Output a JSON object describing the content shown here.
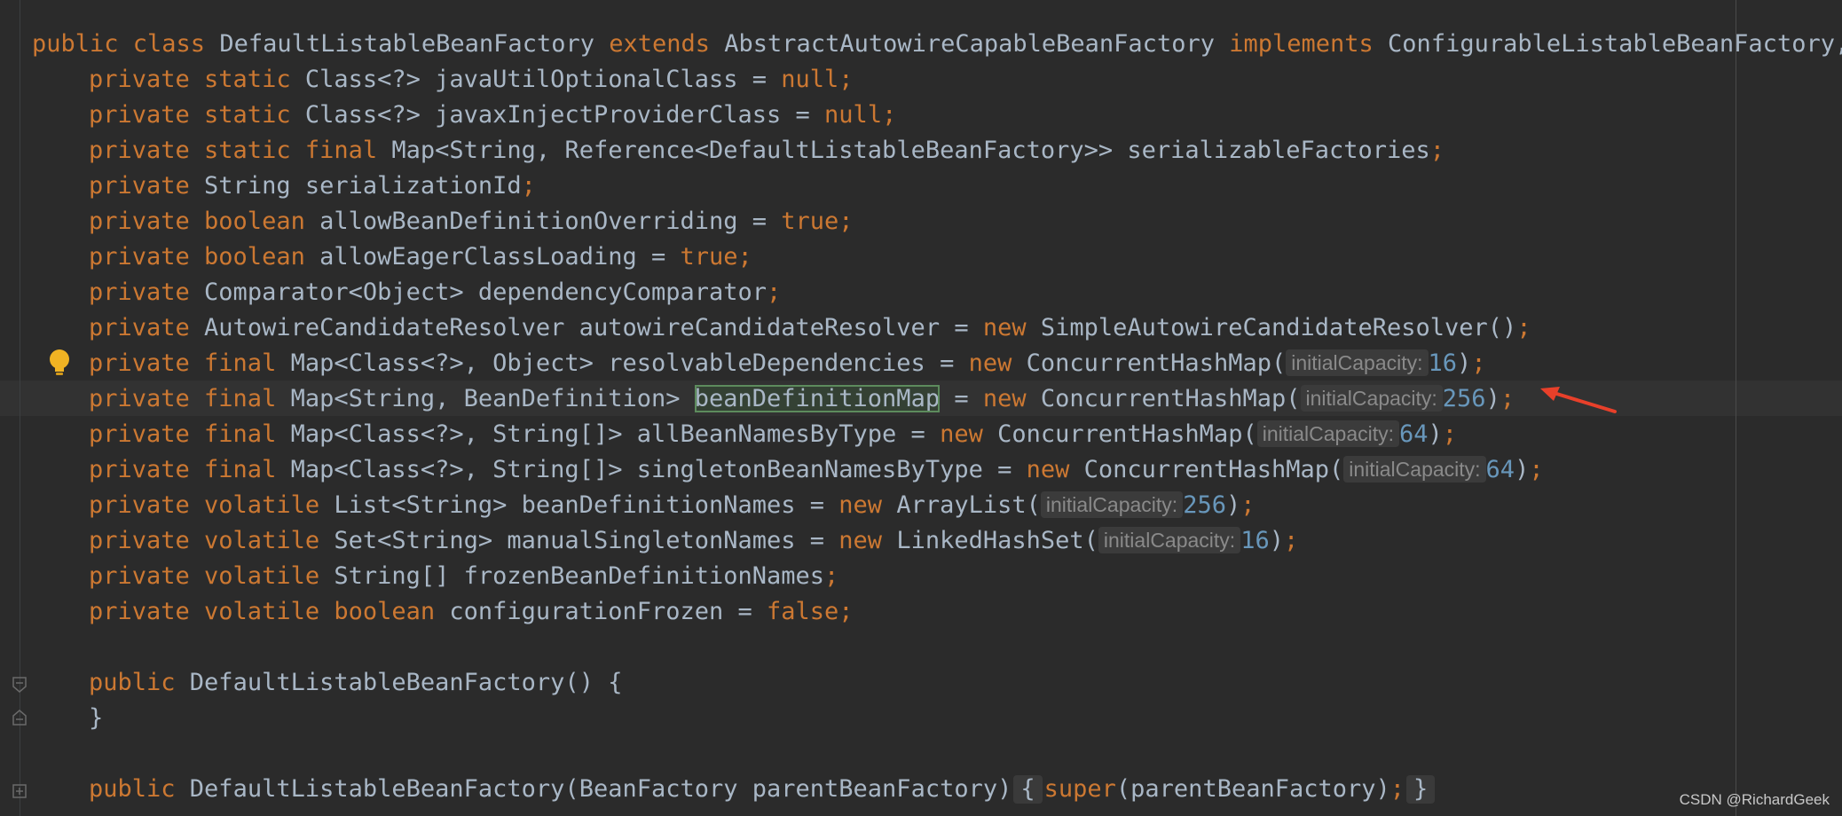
{
  "code": {
    "lines": [
      [
        {
          "t": "public class ",
          "c": "kw"
        },
        {
          "t": "DefaultListableBeanFactory "
        },
        {
          "t": "extends ",
          "c": "kw"
        },
        {
          "t": "AbstractAutowireCapableBeanFactory "
        },
        {
          "t": "implements ",
          "c": "kw"
        },
        {
          "t": "ConfigurableListableBeanFactory, B"
        }
      ],
      [
        {
          "i": 1
        },
        {
          "t": "private static ",
          "c": "kw"
        },
        {
          "t": "Class<?> javaUtilOptionalClass = "
        },
        {
          "t": "null;",
          "c": "kw"
        }
      ],
      [
        {
          "i": 1
        },
        {
          "t": "private static ",
          "c": "kw"
        },
        {
          "t": "Class<?> javaxInjectProviderClass = "
        },
        {
          "t": "null;",
          "c": "kw"
        }
      ],
      [
        {
          "i": 1
        },
        {
          "t": "private static final ",
          "c": "kw"
        },
        {
          "t": "Map<String, Reference<DefaultListableBeanFactory>> serializableFactories"
        },
        {
          "t": ";",
          "c": "kw"
        }
      ],
      [
        {
          "i": 1
        },
        {
          "t": "private ",
          "c": "kw"
        },
        {
          "t": "String serializationId"
        },
        {
          "t": ";",
          "c": "kw"
        }
      ],
      [
        {
          "i": 1
        },
        {
          "t": "private boolean ",
          "c": "kw"
        },
        {
          "t": "allowBeanDefinitionOverriding = "
        },
        {
          "t": "true;",
          "c": "kw"
        }
      ],
      [
        {
          "i": 1
        },
        {
          "t": "private boolean ",
          "c": "kw"
        },
        {
          "t": "allowEagerClassLoading = "
        },
        {
          "t": "true;",
          "c": "kw"
        }
      ],
      [
        {
          "i": 1
        },
        {
          "t": "private ",
          "c": "kw"
        },
        {
          "t": "Comparator<Object> dependencyComparator"
        },
        {
          "t": ";",
          "c": "kw"
        }
      ],
      [
        {
          "i": 1
        },
        {
          "t": "private ",
          "c": "kw"
        },
        {
          "t": "AutowireCandidateResolver autowireCandidateResolver = "
        },
        {
          "t": "new ",
          "c": "kw"
        },
        {
          "t": "SimpleAutowireCandidateResolver()"
        },
        {
          "t": ";",
          "c": "kw"
        }
      ],
      [
        {
          "i": 1
        },
        {
          "t": "private final ",
          "c": "kw"
        },
        {
          "t": "Map<Class<?>, Object> resolvableDependencies = "
        },
        {
          "t": "new ",
          "c": "kw"
        },
        {
          "t": "ConcurrentHashMap("
        },
        {
          "h": "initialCapacity:"
        },
        {
          "t": "16",
          "c": "num"
        },
        {
          "t": ")"
        },
        {
          "t": ";",
          "c": "kw"
        }
      ],
      [
        {
          "i": 1
        },
        {
          "t": "private final ",
          "c": "kw"
        },
        {
          "t": "Map<String, BeanDefinition> "
        },
        {
          "t": "beanDefinitionMap",
          "c": "sel"
        },
        {
          "t": " = "
        },
        {
          "t": "new ",
          "c": "kw"
        },
        {
          "t": "ConcurrentHashMap("
        },
        {
          "h": "initialCapacity:"
        },
        {
          "t": "256",
          "c": "num"
        },
        {
          "t": ")"
        },
        {
          "t": ";",
          "c": "kw"
        }
      ],
      [
        {
          "i": 1
        },
        {
          "t": "private final ",
          "c": "kw"
        },
        {
          "t": "Map<Class<?>, String[]> allBeanNamesByType = "
        },
        {
          "t": "new ",
          "c": "kw"
        },
        {
          "t": "ConcurrentHashMap("
        },
        {
          "h": "initialCapacity:"
        },
        {
          "t": "64",
          "c": "num"
        },
        {
          "t": ")"
        },
        {
          "t": ";",
          "c": "kw"
        }
      ],
      [
        {
          "i": 1
        },
        {
          "t": "private final ",
          "c": "kw"
        },
        {
          "t": "Map<Class<?>, String[]> singletonBeanNamesByType = "
        },
        {
          "t": "new ",
          "c": "kw"
        },
        {
          "t": "ConcurrentHashMap("
        },
        {
          "h": "initialCapacity:"
        },
        {
          "t": "64",
          "c": "num"
        },
        {
          "t": ")"
        },
        {
          "t": ";",
          "c": "kw"
        }
      ],
      [
        {
          "i": 1
        },
        {
          "t": "private volatile ",
          "c": "kw"
        },
        {
          "t": "List<String> beanDefinitionNames = "
        },
        {
          "t": "new ",
          "c": "kw"
        },
        {
          "t": "ArrayList("
        },
        {
          "h": "initialCapacity:"
        },
        {
          "t": "256",
          "c": "num"
        },
        {
          "t": ")"
        },
        {
          "t": ";",
          "c": "kw"
        }
      ],
      [
        {
          "i": 1
        },
        {
          "t": "private volatile ",
          "c": "kw"
        },
        {
          "t": "Set<String> manualSingletonNames = "
        },
        {
          "t": "new ",
          "c": "kw"
        },
        {
          "t": "LinkedHashSet("
        },
        {
          "h": "initialCapacity:"
        },
        {
          "t": "16",
          "c": "num"
        },
        {
          "t": ")"
        },
        {
          "t": ";",
          "c": "kw"
        }
      ],
      [
        {
          "i": 1
        },
        {
          "t": "private volatile ",
          "c": "kw"
        },
        {
          "t": "String[] frozenBeanDefinitionNames"
        },
        {
          "t": ";",
          "c": "kw"
        }
      ],
      [
        {
          "i": 1
        },
        {
          "t": "private volatile boolean ",
          "c": "kw"
        },
        {
          "t": "configurationFrozen = "
        },
        {
          "t": "false;",
          "c": "kw"
        }
      ],
      [],
      [
        {
          "i": 1
        },
        {
          "t": "public ",
          "c": "kw"
        },
        {
          "t": "DefaultListableBeanFactory() {"
        }
      ],
      [
        {
          "i": 1
        },
        {
          "t": "}"
        }
      ],
      [],
      [
        {
          "i": 1
        },
        {
          "t": "public ",
          "c": "kw"
        },
        {
          "t": "DefaultListableBeanFactory(BeanFactory parentBeanFactory)"
        },
        {
          "f": "{"
        },
        {
          "t": "super",
          "c": "kw"
        },
        {
          "t": "(parentBeanFactory)"
        },
        {
          "t": ";",
          "c": "kw"
        },
        {
          "f": "}"
        }
      ]
    ]
  },
  "watermark": "CSDN @RichardGeek",
  "icons": {
    "bulb": "lightbulb-icon",
    "fold_start": "fold-start-icon",
    "fold_end": "fold-end-icon",
    "fold_collapsed": "fold-collapsed-icon",
    "arrow": "red-arrow-annotation"
  },
  "colors": {
    "background": "#2b2b2b",
    "keyword": "#cc7832",
    "text": "#a9b7c6",
    "number": "#6897bb",
    "hint": "#8a8a8a",
    "arrow": "#e8402a",
    "bulb": "#f0b323"
  }
}
